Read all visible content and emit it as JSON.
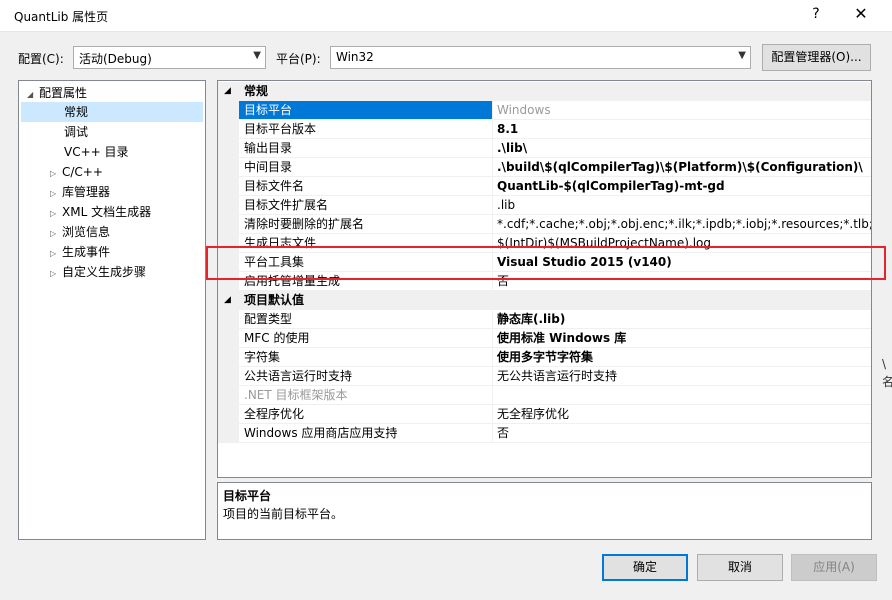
{
  "window": {
    "title": "QuantLib 属性页",
    "help_glyph": "?",
    "close_glyph": "✕"
  },
  "config": {
    "config_label": "配置(C):",
    "config_value": "活动(Debug)",
    "platform_label": "平台(P):",
    "platform_value": "Win32",
    "manager_button": "配置管理器(O)..."
  },
  "tree": {
    "items": [
      {
        "label": "配置属性",
        "expander": "◢"
      },
      {
        "label": "常规"
      },
      {
        "label": "调试"
      },
      {
        "label": "VC++ 目录"
      },
      {
        "label": "C/C++",
        "expander": "▷"
      },
      {
        "label": "库管理器",
        "expander": "▷"
      },
      {
        "label": "XML 文档生成器",
        "expander": "▷"
      },
      {
        "label": "浏览信息",
        "expander": "▷"
      },
      {
        "label": "生成事件",
        "expander": "▷"
      },
      {
        "label": "自定义生成步骤",
        "expander": "▷"
      }
    ]
  },
  "grid": {
    "cat_general": "常规",
    "cat_defaults": "项目默认值",
    "cat_expander": "◢",
    "general_rows": [
      {
        "name": "目标平台",
        "value": "Windows"
      },
      {
        "name": "目标平台版本",
        "value": "8.1"
      },
      {
        "name": "输出目录",
        "value": ".\\lib\\"
      },
      {
        "name": "中间目录",
        "value": ".\\build\\$(qlCompilerTag)\\$(Platform)\\$(Configuration)\\"
      },
      {
        "name": "目标文件名",
        "value": "QuantLib-$(qlCompilerTag)-mt-gd"
      },
      {
        "name": "目标文件扩展名",
        "value": ".lib"
      },
      {
        "name": "清除时要删除的扩展名",
        "value": "*.cdf;*.cache;*.obj;*.obj.enc;*.ilk;*.ipdb;*.iobj;*.resources;*.tlb;*.tli;*.t"
      },
      {
        "name": "生成日志文件",
        "value": "$(IntDir)$(MSBuildProjectName).log"
      },
      {
        "name": "平台工具集",
        "value": "Visual Studio 2015 (v140)"
      },
      {
        "name": "启用托管增量生成",
        "value": "否"
      }
    ],
    "default_rows": [
      {
        "name": "配置类型",
        "value": "静态库(.lib)"
      },
      {
        "name": "MFC 的使用",
        "value": "使用标准 Windows 库"
      },
      {
        "name": "字符集",
        "value": "使用多字节字符集"
      },
      {
        "name": "公共语言运行时支持",
        "value": "无公共语言运行时支持"
      },
      {
        "name": ".NET 目标框架版本",
        "value": ""
      },
      {
        "name": "全程序优化",
        "value": "无全程序优化"
      },
      {
        "name": "Windows 应用商店应用支持",
        "value": "否"
      }
    ]
  },
  "description": {
    "title": "目标平台",
    "text": "项目的当前目标平台。"
  },
  "buttons": {
    "ok": "确定",
    "cancel": "取消",
    "apply": "应用(A)"
  },
  "edge_fragments": [
    "\\",
    "名"
  ],
  "colors": {
    "selection": "#0078d7",
    "highlight_box": "#e8222a"
  }
}
